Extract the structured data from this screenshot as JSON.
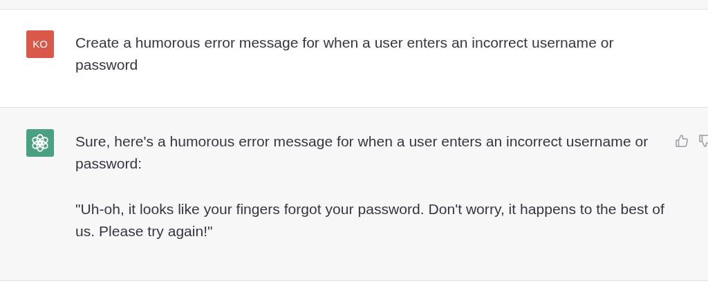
{
  "messages": [
    {
      "kind": "user",
      "avatar_text": "KO",
      "paragraphs": [
        "Create a humorous error message for when a user enters an incorrect username or password"
      ]
    },
    {
      "kind": "assistant",
      "paragraphs": [
        "Sure, here's a humorous error message for when a user enters an incorrect username or password:",
        "\"Uh-oh, it looks like your fingers forgot your password. Don't worry, it happens to the best of us. Please try again!\""
      ]
    }
  ]
}
